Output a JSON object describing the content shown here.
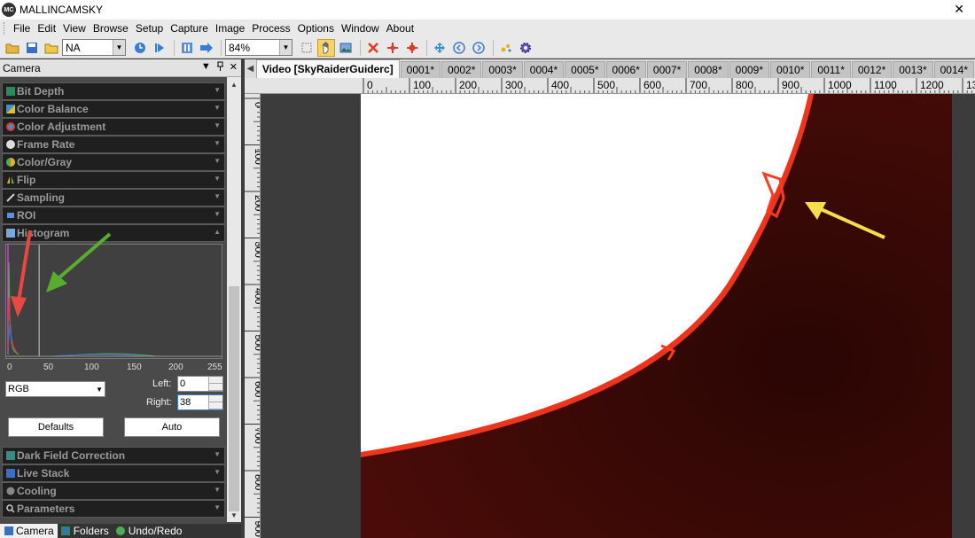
{
  "app": {
    "logo_text": "MC",
    "title": "MALLINCAMSKY",
    "close_glyph": "✕"
  },
  "menu": [
    "File",
    "Edit",
    "View",
    "Browse",
    "Setup",
    "Capture",
    "Image",
    "Process",
    "Options",
    "Window",
    "About"
  ],
  "toolbar": {
    "camera_select": "NA",
    "zoom": "84%"
  },
  "panel": {
    "title": "Camera",
    "sections_top": [
      "Bit Depth",
      "Color Balance",
      "Color Adjustment",
      "Frame Rate",
      "Color/Gray",
      "Flip",
      "Sampling",
      "ROI",
      "Histogram"
    ],
    "sections_bottom": [
      "Dark Field Correction",
      "Live Stack",
      "Cooling",
      "Parameters"
    ],
    "histogram": {
      "axis": [
        "0",
        "50",
        "100",
        "150",
        "200",
        "255"
      ],
      "channel": "RGB",
      "left_label": "Left:",
      "left_value": "0",
      "right_label": "Right:",
      "right_value": "38",
      "defaults_button": "Defaults",
      "auto_button": "Auto",
      "marker_value": 38
    }
  },
  "bottom_tabs": [
    "Camera",
    "Folders",
    "Undo/Redo"
  ],
  "doc_tabs": [
    "Video [SkyRaiderGuiderc]",
    "0001*",
    "0002*",
    "0003*",
    "0004*",
    "0005*",
    "0006*",
    "0007*",
    "0008*",
    "0009*",
    "0010*",
    "0011*",
    "0012*",
    "0013*",
    "0014*"
  ],
  "ruler_top": [
    "0",
    "100",
    "200",
    "300",
    "400",
    "500",
    "600",
    "700",
    "800",
    "900",
    "1000",
    "1100",
    "1200",
    "13"
  ],
  "ruler_left": [
    "0",
    "100",
    "200",
    "300",
    "400",
    "500",
    "600",
    "700",
    "800",
    "900"
  ],
  "colors": {
    "sun_disk": "#ffffff",
    "sun_limb": "#ff3a1e",
    "sky": "#2a0604",
    "arrow_red": "#e84840",
    "arrow_green": "#59ad2e",
    "arrow_yellow": "#f2df4a",
    "panel_dark": "#1f1f1f",
    "focus_blue": "#3a7bd5"
  }
}
